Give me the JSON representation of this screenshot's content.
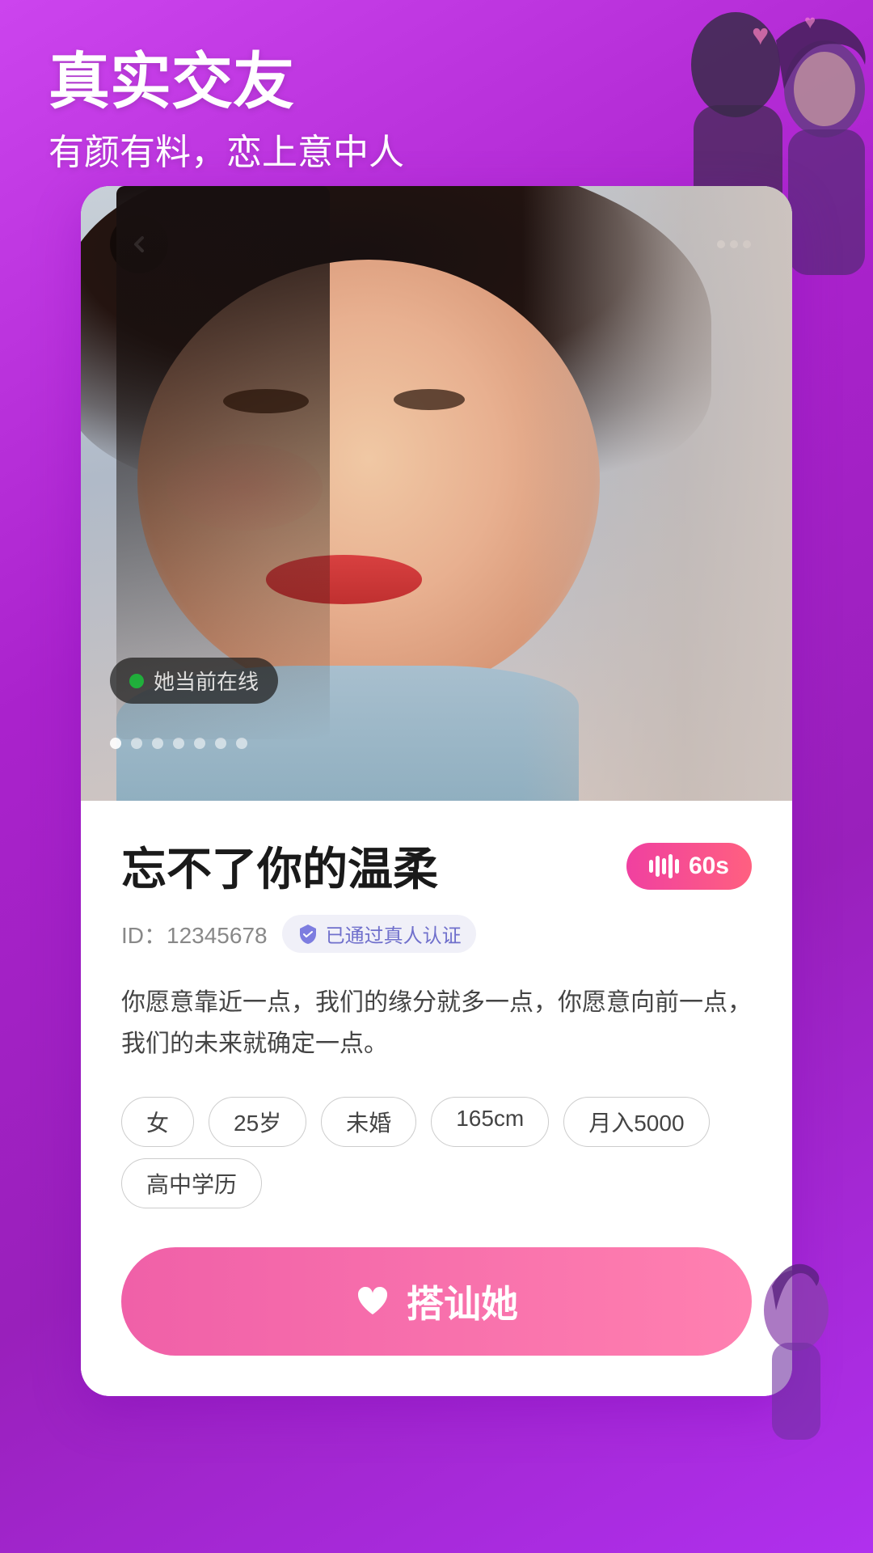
{
  "app": {
    "background_gradient_start": "#c040e8",
    "background_gradient_end": "#9020c0"
  },
  "header": {
    "title": "真实交友",
    "subtitle": "有颜有料，恋上意中人"
  },
  "photo": {
    "online_status": "她当前在线",
    "dots_count": 7,
    "active_dot": 0
  },
  "profile": {
    "name": "忘不了你的温柔",
    "id_label": "ID：",
    "id_value": "12345678",
    "verified_text": "已通过真人认证",
    "voice_duration": "60s",
    "bio": "你愿意靠近一点，我们的缘分就多一点，你愿意向前一点，我们的未来就确定一点。",
    "tags": [
      "女",
      "25岁",
      "未婚",
      "165cm",
      "月入5000",
      "高中学历"
    ],
    "cta_label": "搭讪她"
  },
  "icons": {
    "back": "chevron-left",
    "more": "ellipsis",
    "heart": "heart",
    "verified": "shield-check",
    "voice_bars": "audio-waveform"
  }
}
